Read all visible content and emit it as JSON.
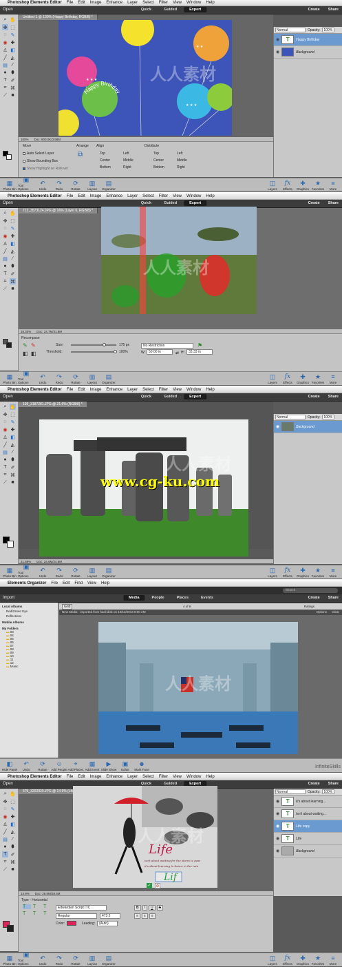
{
  "screens": [
    {
      "menu": {
        "app": "Photoshop Elements Editor",
        "items": [
          "File",
          "Edit",
          "Image",
          "Enhance",
          "Layer",
          "Select",
          "Filter",
          "View",
          "Window",
          "Help"
        ]
      },
      "modes": [
        "Quick",
        "Guided",
        "Expert"
      ],
      "active_mode": "Expert",
      "open_label": "Open",
      "create_label": "Create",
      "share_label": "Share",
      "doc_tab": "Untitled-1 @ 100% (Happy Birthday, RGB/8) *",
      "status": {
        "zoom": "100%",
        "doc": "Doc: 900.0K/3.58M"
      },
      "blend_mode": "Normal",
      "opacity_label": "Opacity:",
      "opacity_value": "100%",
      "layers": [
        {
          "name": "Happy Birthday",
          "selected": true,
          "type": "text"
        },
        {
          "name": "Background",
          "selected": false,
          "type": "image"
        }
      ],
      "canvas_text": "Happy Birthday",
      "options": {
        "title": "Move",
        "checkboxes": [
          "Auto Select Layer",
          "Show Bounding Box",
          "Show Highlight on Rollover"
        ],
        "arrange_label": "Arrange",
        "align_label": "Align",
        "align": [
          "Top",
          "Left",
          "Center",
          "Middle",
          "Bottom",
          "Right"
        ],
        "distribute_label": "Distribute",
        "distribute": [
          "Top",
          "Left",
          "Center",
          "Middle",
          "Bottom",
          "Right"
        ]
      }
    },
    {
      "menu": {
        "app": "Photoshop Elements Editor",
        "items": [
          "File",
          "Edit",
          "Image",
          "Enhance",
          "Layer",
          "Select",
          "Filter",
          "View",
          "Window",
          "Help"
        ]
      },
      "modes": [
        "Quick",
        "Guided",
        "Expert"
      ],
      "active_mode": "Expert",
      "open_label": "Open",
      "create_label": "Create",
      "share_label": "Share",
      "doc_tab": "713_3573124.JPG @ 16% (Layer 0, RGB/8) *",
      "status": {
        "zoom": "16.03%",
        "doc": "Doc: 24.7M/31.8M"
      },
      "options": {
        "title": "Recompose",
        "size_label": "Size:",
        "size_value": "175 px",
        "threshold_label": "Threshold:",
        "threshold_value": "100%",
        "ratio": "No Restriction",
        "w_label": "W:",
        "w_value": "50.00 in",
        "h_label": "H:",
        "h_value": "33.33 in"
      }
    },
    {
      "menu": {
        "app": "Photoshop Elements Editor",
        "items": [
          "File",
          "Edit",
          "Image",
          "Enhance",
          "Layer",
          "Select",
          "Filter",
          "View",
          "Window",
          "Help"
        ]
      },
      "modes": [
        "Quick",
        "Guided",
        "Expert"
      ],
      "active_mode": "Expert",
      "open_label": "Open",
      "create_label": "Create",
      "share_label": "Share",
      "doc_tab": "136_3187281.JPG @ 21.6% (RGB/8) *",
      "status": {
        "zoom": "21.59%",
        "doc": "Doc: 24.6M/24.6M"
      },
      "blend_mode": "Normal",
      "opacity_label": "Opacity:",
      "opacity_value": "100%",
      "layers": [
        {
          "name": "Background",
          "selected": true,
          "type": "image"
        }
      ],
      "watermark": "www.cg-ku.com"
    },
    {
      "menu": {
        "app": "Elements Organizer",
        "items": [
          "File",
          "Edit",
          "Find",
          "View",
          "Help"
        ]
      },
      "org_tabs": [
        "Media",
        "People",
        "Places",
        "Events"
      ],
      "active_tab": "Media",
      "import_label": "Import",
      "search_placeholder": "Search",
      "create_label": "Create",
      "share_label": "Share",
      "grid_label": "Grid",
      "page_count": "4 of 6",
      "ratings_label": "Ratings",
      "media_info": "New Media - imported from hard disk on 10/13/2013 9:00 AM",
      "options_label": "Options",
      "clear_label": "Clear",
      "left": {
        "local_albums": "Local Albums",
        "albums": [
          "Red/Green Eye",
          "Reflections"
        ],
        "mobile_albums": "Mobile Albums",
        "my_folders": "My Folders",
        "folders": [
          "03",
          "04",
          "05",
          "06",
          "07",
          "08",
          "09",
          "10",
          "11",
          "12",
          "Music"
        ]
      },
      "zoom_label": "Zoom",
      "bottom_buttons": [
        "Hide Panel",
        "Undo",
        "Rotate",
        "Add People",
        "Add Places",
        "Add Event",
        "Slide Show",
        "Editor",
        "Mark Face"
      ]
    },
    {
      "menu": {
        "app": "Photoshop Elements Editor",
        "items": [
          "File",
          "Edit",
          "Image",
          "Enhance",
          "Layer",
          "Select",
          "Filter",
          "View",
          "Window",
          "Help"
        ]
      },
      "modes": [
        "Quick",
        "Guided",
        "Expert"
      ],
      "active_mode": "Expert",
      "open_label": "Open",
      "create_label": "Create",
      "share_label": "Share",
      "doc_tab": "575_3202020.JPG @ 14.9% (Life copy, RGB/8) *",
      "status": {
        "zoom": "14.9%",
        "doc": "Doc: 28.6M/38.6M"
      },
      "blend_mode": "Normal",
      "opacity_label": "Opacity:",
      "opacity_value": "100%",
      "layers": [
        {
          "name": "it's about learning...",
          "selected": false,
          "type": "text"
        },
        {
          "name": "isn't about waiting...",
          "selected": false,
          "type": "text"
        },
        {
          "name": "Life copy",
          "selected": true,
          "type": "text"
        },
        {
          "name": "Life",
          "selected": false,
          "type": "text"
        },
        {
          "name": "Background",
          "selected": false,
          "type": "image"
        }
      ],
      "canvas_text": {
        "life": "Life",
        "line": "isn't about waiting for the storm to pass",
        "line2": "it's about learning to dance in the rain"
      },
      "options": {
        "title": "Type - Horizontal",
        "font": "Edwardian Script ITC",
        "style": "Regular",
        "size": "473.2",
        "leading_label": "Leading:",
        "leading": "(Auto)",
        "color_label": "Color:",
        "bold": "B",
        "italic": "I",
        "underline": "U",
        "strike": "S"
      }
    }
  ],
  "taskbar": {
    "left": [
      "Photo Bin",
      "Tool Options",
      "Undo",
      "Redo",
      "Rotate",
      "Layout",
      "Organizer"
    ],
    "right": [
      "Layers",
      "Effects",
      "Graphics",
      "Favorites",
      "More"
    ],
    "fx_label": "fx"
  },
  "overlay_watermark": "人人素材",
  "infinite_skills": "InfiniteSkills",
  "colors": {
    "selection_blue": "#6a9ad0",
    "accent": "#2867b0",
    "balloon_bg": "#3d54b8"
  }
}
